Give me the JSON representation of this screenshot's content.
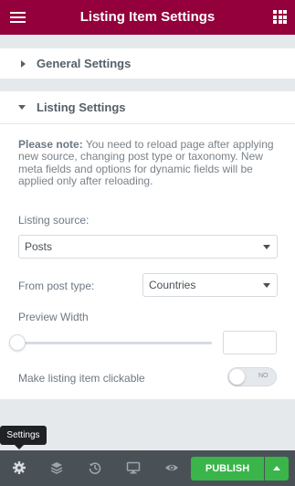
{
  "header": {
    "title": "Listing Item Settings",
    "menu_icon": "hamburger-icon",
    "apps_icon": "grid-icon"
  },
  "sections": {
    "general": {
      "label": "General Settings"
    },
    "listing": {
      "label": "Listing Settings"
    }
  },
  "note": {
    "strong": "Please note:",
    "text": " You need to reload page after applying new source, changing post type or taxonomy. New meta fields and options for dynamic fields will be applied only after reloading."
  },
  "listing_source": {
    "label": "Listing source:",
    "value": "Posts"
  },
  "post_type": {
    "label": "From post type:",
    "value": "Countries"
  },
  "preview_width": {
    "label": "Preview Width",
    "value": "",
    "slider_percent": 0
  },
  "clickable": {
    "label": "Make listing item clickable",
    "toggle_text": "NO"
  },
  "tooltip": {
    "text": "Settings"
  },
  "footer": {
    "publish_label": "PUBLISH"
  },
  "colors": {
    "brand": "#93003c",
    "publish": "#39b54a",
    "footer": "#495157"
  }
}
